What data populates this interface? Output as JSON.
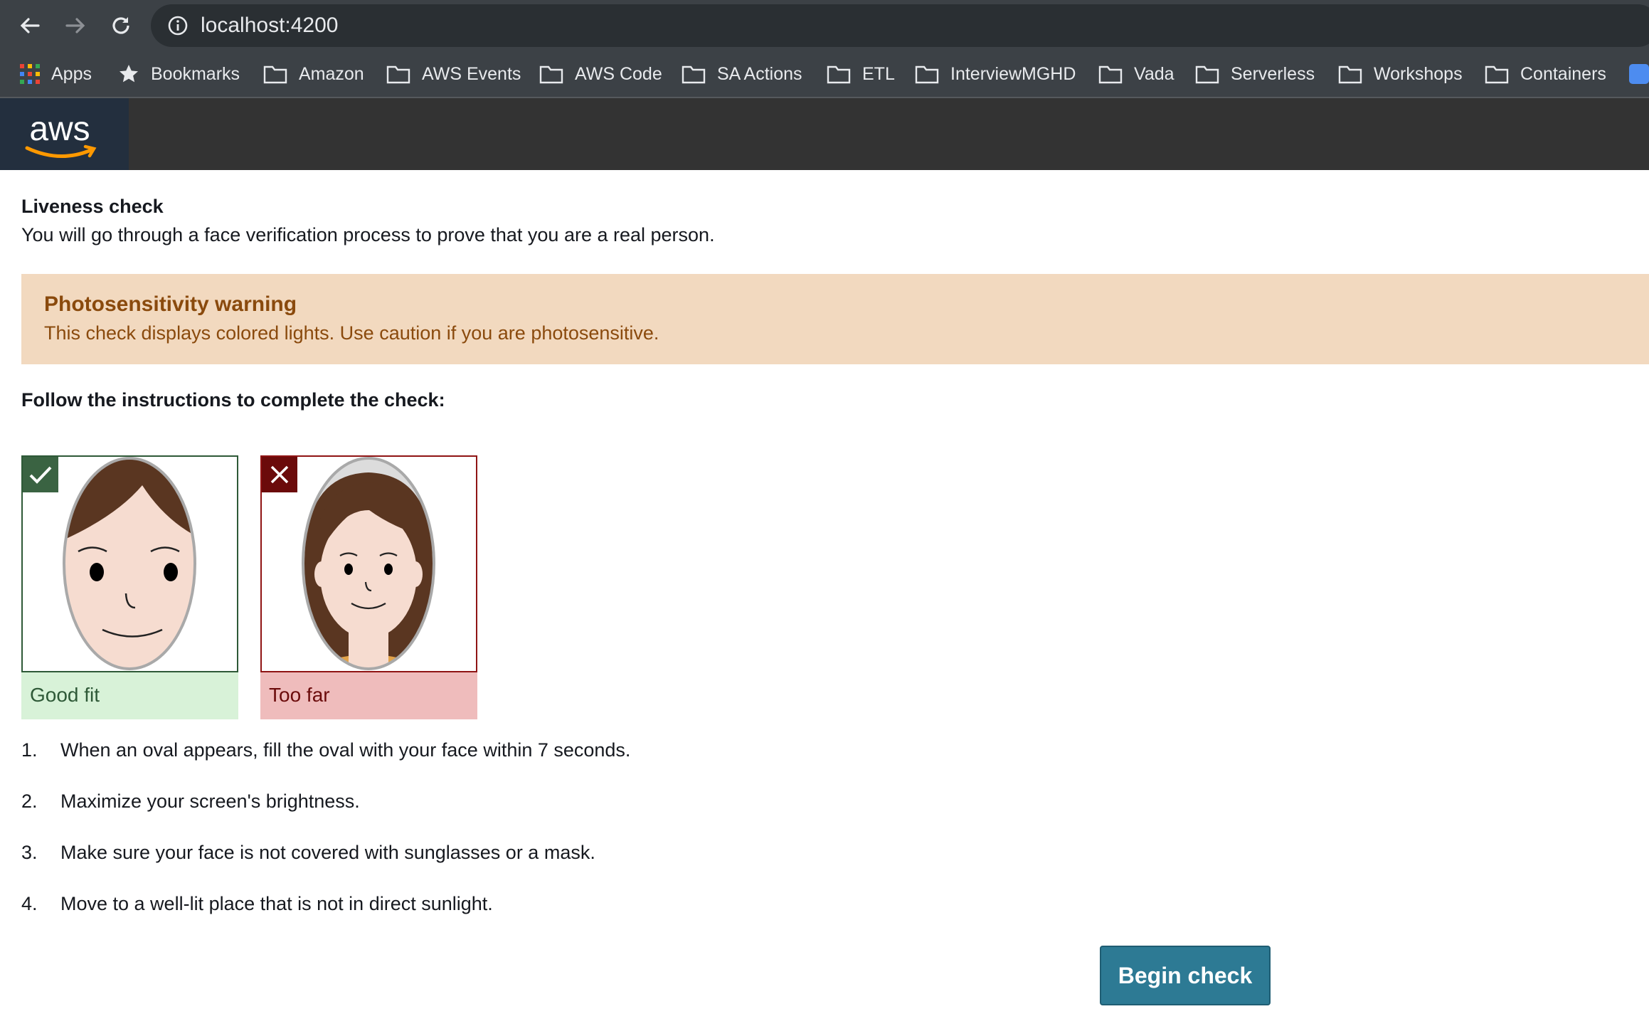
{
  "browser": {
    "url": "localhost:4200",
    "bookmarks": [
      "Apps",
      "Bookmarks",
      "Amazon",
      "AWS Events",
      "AWS Code",
      "SA Actions",
      "ETL",
      "InterviewMGHD",
      "Vada",
      "Serverless",
      "Workshops",
      "Containers"
    ]
  },
  "header": {
    "logo_text": "aws"
  },
  "liveness": {
    "title": "Liveness check",
    "subtitle": "You will go through a face verification process to prove that you are a real person.",
    "warning_title": "Photosensitivity warning",
    "warning_body": "This check displays colored lights. Use caution if you are photosensitive.",
    "instructions_heading": "Follow the instructions to complete the check:",
    "examples": [
      {
        "label": "Good fit",
        "status": "correct"
      },
      {
        "label": "Too far",
        "status": "incorrect"
      }
    ],
    "steps": [
      {
        "num": "1.",
        "text": "When an oval appears, fill the oval with your face within 7 seconds."
      },
      {
        "num": "2.",
        "text": "Maximize your screen's brightness."
      },
      {
        "num": "3.",
        "text": "Make sure your face is not covered with sunglasses or a mask."
      },
      {
        "num": "4.",
        "text": "Move to a well-lit place that is not in direct sunlight."
      }
    ],
    "begin_label": "Begin check"
  },
  "colors": {
    "warning_bg": "#f2d9bf",
    "warning_text": "#8a4a0d",
    "good_bg": "#d8f2d8",
    "bad_bg": "#efbcbc",
    "button": "#2d7a94"
  }
}
